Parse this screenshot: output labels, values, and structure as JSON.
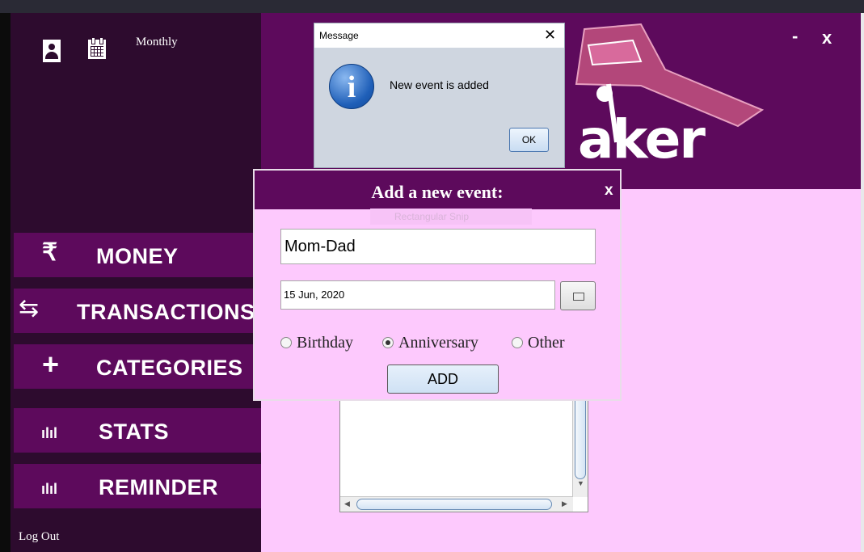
{
  "app": {
    "view_mode": "Monthly",
    "logo_text": "aker",
    "window_min": "-",
    "window_close": "x"
  },
  "sidebar": {
    "items": [
      {
        "label": "MONEY",
        "icon": "₹"
      },
      {
        "label": "TRANSACTIONS",
        "icon": "⇆"
      },
      {
        "label": "CATEGORIES",
        "icon": "+"
      },
      {
        "label": "STATS",
        "icon": "ılıl"
      },
      {
        "label": "REMINDER",
        "icon": "ılıl"
      }
    ],
    "logout": "Log Out"
  },
  "message_dialog": {
    "title": "Message",
    "close": "✕",
    "text": "New event is added",
    "ok": "OK",
    "icon": "i"
  },
  "add_event_dialog": {
    "title": "Add a new event:",
    "close": "x",
    "name_value": "Mom-Dad",
    "date_value": "15 Jun, 2020",
    "ghost_text": "Rectangular Snip",
    "radios": [
      {
        "label": "Birthday",
        "selected": false
      },
      {
        "label": "Anniversary",
        "selected": true
      },
      {
        "label": "Other",
        "selected": false
      }
    ],
    "add_button": "ADD"
  },
  "colors": {
    "sidebar_bg": "#2d0b2e",
    "nav_bg": "#5d0a5c",
    "content_bg": "#fdc9fd"
  }
}
